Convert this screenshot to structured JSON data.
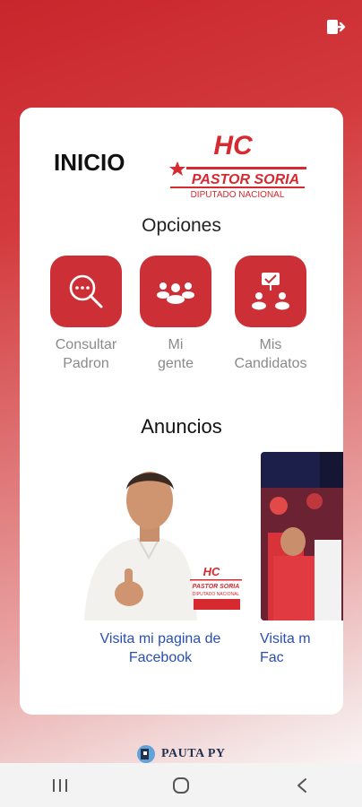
{
  "header": {
    "title": "INICIO",
    "logout_icon": "logout-icon"
  },
  "brand": {
    "top": "HC",
    "name": "PASTOR SORIA",
    "subtitle": "DIPUTADO NACIONAL"
  },
  "options": {
    "title": "Opciones",
    "items": [
      {
        "label": "Consultar\nPadron",
        "icon": "search-chat-icon"
      },
      {
        "label": "Mi\ngente",
        "icon": "people-group-icon"
      },
      {
        "label": "Mis\nCandidatos",
        "icon": "candidates-vote-icon"
      }
    ]
  },
  "announcements": {
    "title": "Anuncios",
    "items": [
      {
        "link": "Visita mi pagina de\nFacebook",
        "poster_hc": "HC",
        "poster_name": "PASTOR SORIA",
        "poster_sub": "DIPUTADO NACIONAL"
      },
      {
        "link": "Visita m\nFac"
      }
    ]
  },
  "footer": {
    "brand": "PAUTA PY"
  },
  "colors": {
    "accent": "#cc2f35",
    "link": "#2a4fb3"
  }
}
